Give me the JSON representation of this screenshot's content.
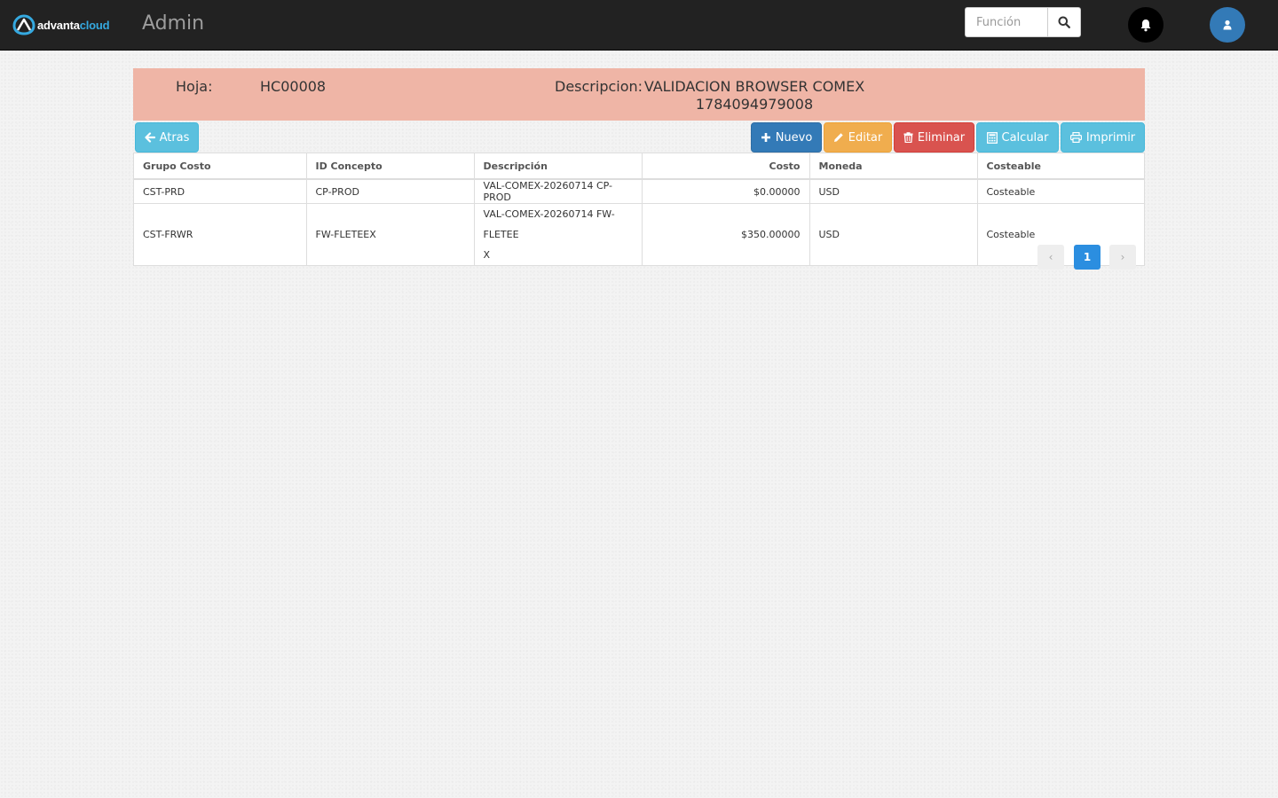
{
  "navbar": {
    "logo_part1": "advanta",
    "logo_part2": "cloud",
    "title": "Admin",
    "search_placeholder": "Función",
    "search_icon": "search-icon",
    "notification_icon": "bell-icon",
    "user_icon": "user-icon"
  },
  "header": {
    "hoja_label": "Hoja:",
    "hoja_value": "HC00008",
    "descripcion_label": "Descripcion:",
    "descripcion_value_line1": "VALIDACION BROWSER COMEX",
    "descripcion_value_line2": "1784094979008"
  },
  "toolbar": {
    "back_label": "Atras",
    "new_label": "Nuevo",
    "edit_label": "Editar",
    "delete_label": "Eliminar",
    "calc_label": "Calcular",
    "print_label": "Imprimir"
  },
  "table": {
    "headers": [
      "Grupo Costo",
      "ID Concepto",
      "Descripción",
      "Costo",
      "Moneda",
      "Costeable"
    ],
    "rows": [
      [
        "CST-PRD",
        "CP-PROD",
        "VAL-COMEX-20260714 CP-PROD",
        "$0.00000",
        "USD",
        "Costeable"
      ],
      [
        "CST-FRWR",
        "FW-FLETEEX",
        "VAL-COMEX-20260714 FW-FLETEEX",
        "$350.00000",
        "USD",
        "Costeable"
      ]
    ],
    "row2_desc_line1": "VAL-COMEX-20260714 FW-FLETEE",
    "row2_desc_line2": "X"
  },
  "pagination": {
    "prev": "‹",
    "current": "1",
    "next": "›"
  },
  "colors": {
    "navbar": "#222222",
    "header_band": "#efb5a6",
    "primary": "#337ab7",
    "warning": "#f0ad4e",
    "danger": "#d9534f",
    "info": "#5bc0de",
    "pager_active": "#2b8ee0"
  }
}
